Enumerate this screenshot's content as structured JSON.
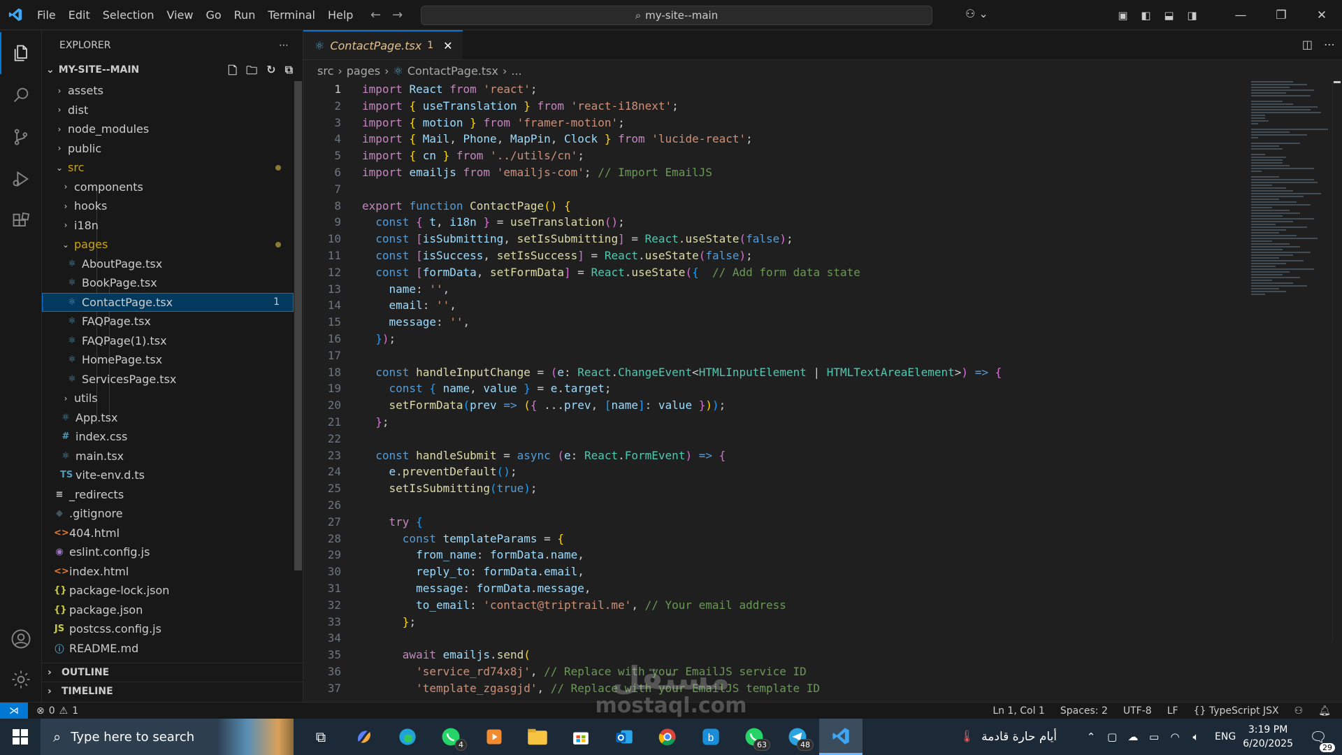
{
  "titlebar": {
    "menu": [
      "File",
      "Edit",
      "Selection",
      "View",
      "Go",
      "Run",
      "Terminal",
      "Help"
    ],
    "search_text": "my-site--main",
    "colors": {
      "accent": "#0078d4",
      "bg": "#181818"
    }
  },
  "explorer": {
    "header": "EXPLORER",
    "project": "MY-SITE--MAIN",
    "items": [
      {
        "label": "assets",
        "type": "folder",
        "open": false
      },
      {
        "label": "dist",
        "type": "folder",
        "open": false
      },
      {
        "label": "node_modules",
        "type": "folder",
        "open": false
      },
      {
        "label": "public",
        "type": "folder",
        "open": false
      },
      {
        "label": "src",
        "type": "folder",
        "open": true
      },
      {
        "label": "components",
        "type": "folder",
        "open": false
      },
      {
        "label": "hooks",
        "type": "folder",
        "open": false
      },
      {
        "label": "i18n",
        "type": "folder",
        "open": false
      },
      {
        "label": "pages",
        "type": "folder",
        "open": true
      },
      {
        "label": "AboutPage.tsx",
        "type": "react"
      },
      {
        "label": "BookPage.tsx",
        "type": "react"
      },
      {
        "label": "ContactPage.tsx",
        "type": "react",
        "badge": "1"
      },
      {
        "label": "FAQPage.tsx",
        "type": "react"
      },
      {
        "label": "FAQPage(1).tsx",
        "type": "react"
      },
      {
        "label": "HomePage.tsx",
        "type": "react"
      },
      {
        "label": "ServicesPage.tsx",
        "type": "react"
      },
      {
        "label": "utils",
        "type": "folder",
        "open": false
      },
      {
        "label": "App.tsx",
        "type": "react"
      },
      {
        "label": "index.css",
        "type": "css",
        "icon": "#"
      },
      {
        "label": "main.tsx",
        "type": "react"
      },
      {
        "label": "vite-env.d.ts",
        "type": "ts",
        "icon": "TS"
      },
      {
        "label": "_redirects",
        "type": "text",
        "icon": "≡"
      },
      {
        "label": ".gitignore",
        "type": "git",
        "icon": "◆"
      },
      {
        "label": "404.html",
        "type": "html",
        "icon": "<>"
      },
      {
        "label": "eslint.config.js",
        "type": "eslint",
        "icon": "◉"
      },
      {
        "label": "index.html",
        "type": "html",
        "icon": "<>"
      },
      {
        "label": "package-lock.json",
        "type": "json",
        "icon": "{}"
      },
      {
        "label": "package.json",
        "type": "json",
        "icon": "{}"
      },
      {
        "label": "postcss.config.js",
        "type": "js",
        "icon": "JS"
      },
      {
        "label": "README.md",
        "type": "md",
        "icon": "ⓘ"
      }
    ],
    "outline": "OUTLINE",
    "timeline": "TIMELINE"
  },
  "editor": {
    "tab_name": "ContactPage.tsx",
    "tab_badge": "1",
    "breadcrumb": [
      "src",
      "pages",
      "ContactPage.tsx",
      "..."
    ]
  },
  "statusbar": {
    "errors": "0",
    "warnings": "1",
    "position": "Ln 1, Col 1",
    "spaces": "Spaces: 2",
    "encoding": "UTF-8",
    "eol": "LF",
    "language": "TypeScript JSX"
  },
  "taskbar": {
    "search_placeholder": "Type here to search",
    "badges": {
      "whatsapp": "4",
      "whatsapp2": "63",
      "telegram": "48"
    },
    "weather": "أيام حارة قادمة",
    "lang": "ENG",
    "time": "3:19 PM",
    "date": "6/20/2025",
    "notifications": "29"
  },
  "watermark": {
    "line1": "مستقل",
    "line2": "mostaql.com"
  }
}
